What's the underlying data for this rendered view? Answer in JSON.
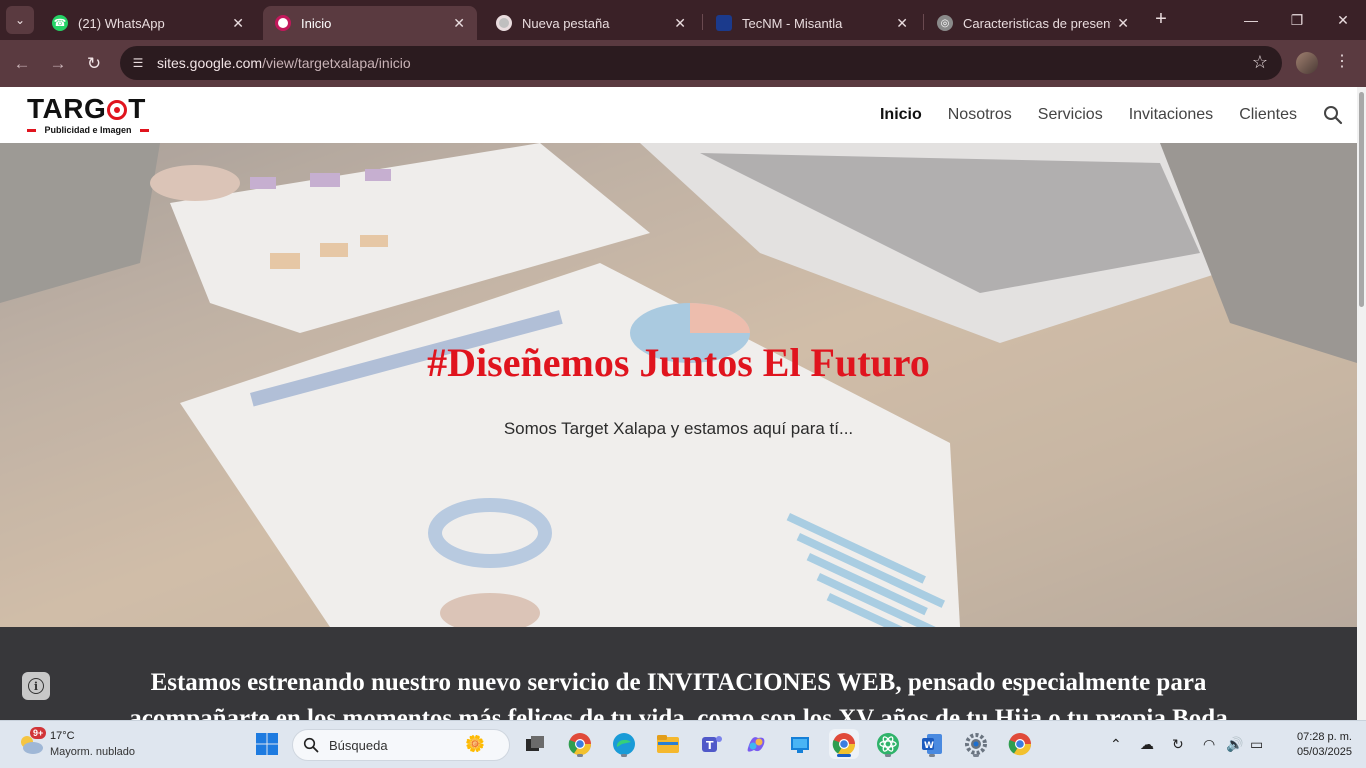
{
  "browser": {
    "tabs": [
      {
        "title": "(21) WhatsApp",
        "icon": "whatsapp-icon",
        "active": false
      },
      {
        "title": "Inicio",
        "icon": "google-sites-icon",
        "active": true
      },
      {
        "title": "Nueva pestaña",
        "icon": "chrome-icon",
        "active": false
      },
      {
        "title": "TecNM - Misantla",
        "icon": "tecnm-icon",
        "active": false
      },
      {
        "title": "Caracteristicas de presentaci",
        "icon": "globe-icon",
        "active": false
      }
    ],
    "url_host": "sites.google.com",
    "url_path": "/view/targetxalapa/inicio"
  },
  "site": {
    "logo_text_1": "TARG",
    "logo_text_2": "T",
    "logo_sub": "Publicidad e Imagen",
    "nav": [
      {
        "label": "Inicio",
        "active": true
      },
      {
        "label": "Nosotros",
        "active": false
      },
      {
        "label": "Servicios",
        "active": false
      },
      {
        "label": "Invitaciones",
        "active": false
      },
      {
        "label": "Clientes",
        "active": false
      }
    ],
    "hero_title": "#Diseñemos Juntos El Futuro",
    "hero_subtitle": "Somos Target Xalapa y estamos aquí para tí...",
    "announcement": "Estamos estrenando nuestro nuevo servicio de INVITACIONES WEB, pensado especialmente para acompañarte en los momentos más felices de tu vida, como son los XV años de tu Hija o tu propia Boda",
    "colors": {
      "brand_red": "#e0141e",
      "announce_bg": "#37373a"
    }
  },
  "taskbar": {
    "weather_badge": "9+",
    "temperature": "17°C",
    "condition": "Mayorm. nublado",
    "search_placeholder": "Búsqueda",
    "time": "07:28 p. m.",
    "date": "05/03/2025"
  }
}
